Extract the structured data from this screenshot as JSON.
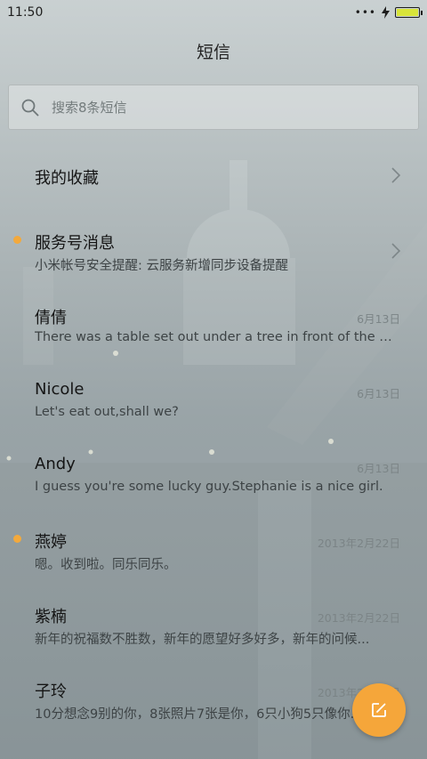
{
  "status": {
    "time": "11:50",
    "signal": "•••",
    "battery_level": 0.92
  },
  "header": {
    "title": "短信"
  },
  "search": {
    "placeholder": "搜索8条短信"
  },
  "favorites": {
    "label": "我的收藏"
  },
  "threads": [
    {
      "name": "服务号消息",
      "snippet": "小米帐号安全提醒: 云服务新增同步设备提醒",
      "date": "",
      "unread": true,
      "chevron": true
    },
    {
      "name": "倩倩",
      "snippet": "There was a table set out under a tree in front of the h...",
      "date": "6月13日",
      "unread": false
    },
    {
      "name": "Nicole",
      "snippet": "Let's eat out,shall we?",
      "date": "6月13日",
      "unread": false
    },
    {
      "name": "Andy",
      "snippet": "I guess you're some lucky guy.Stephanie is a nice girl.",
      "date": "6月13日",
      "unread": false
    },
    {
      "name": "燕婷",
      "snippet": "嗯。收到啦。同乐同乐。",
      "date": "2013年2月22日",
      "unread": true
    },
    {
      "name": "紫楠",
      "snippet": "新年的祝福数不胜数，新年的愿望好多好多，新年的问候...",
      "date": "2013年2月22日",
      "unread": false
    },
    {
      "name": "子玲",
      "snippet": "10分想念9别的你，8张照片7张是你，6只小狗5只像你...",
      "date": "2013年2月22日",
      "unread": false
    }
  ],
  "icons": {
    "search": "search-icon",
    "chevron": "chevron-right-icon",
    "compose": "compose-icon"
  },
  "colors": {
    "accent": "#f5a63a",
    "unread_dot": "#f3a93c"
  }
}
